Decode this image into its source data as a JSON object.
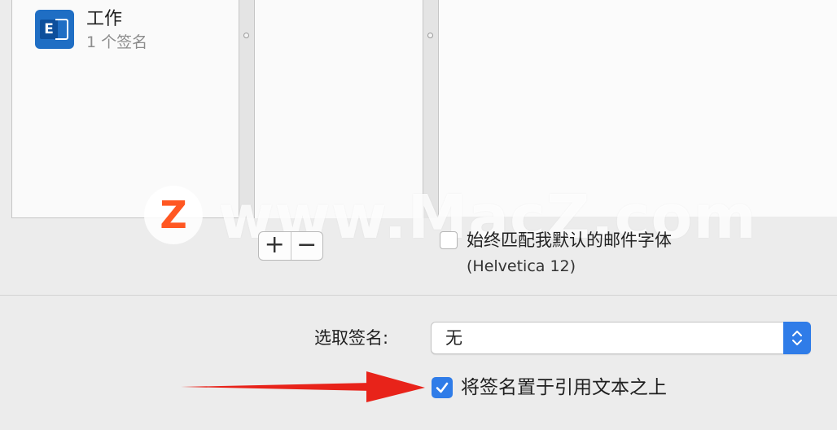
{
  "accounts": {
    "items": [
      {
        "name": "工作",
        "signature_count": "1 个签名",
        "icon": "exchange-icon"
      }
    ]
  },
  "buttons": {
    "add_label": "+",
    "remove_label": "−"
  },
  "font_option": {
    "label": "始终匹配我默认的邮件字体",
    "font_name": "(Helvetica 12)",
    "checked": false
  },
  "choose_signature": {
    "label": "选取签名:",
    "selected": "无"
  },
  "quote_option": {
    "label": "将签名置于引用文本之上",
    "checked": true
  },
  "watermark": {
    "logo_letter": "Z",
    "text": "www.MacZ.com"
  },
  "colors": {
    "accent": "#2f7ce8",
    "arrow": "#e8231a",
    "exchange_blue": "#1f6ec4",
    "watermark_logo": "#ff5722"
  }
}
